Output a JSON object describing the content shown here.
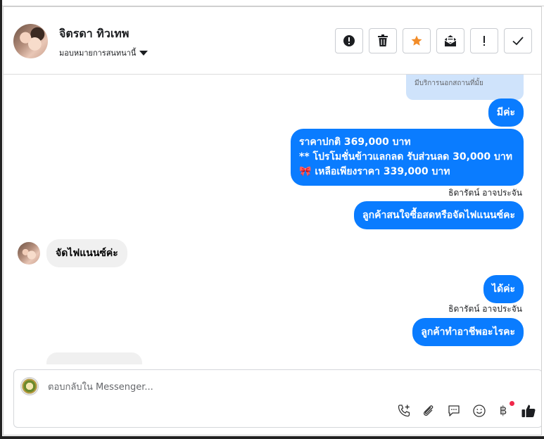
{
  "header": {
    "contact_name": "จิตรดา ทิวเทพ",
    "assign_label": "มอบหมายการสนทนานี้"
  },
  "toolbar": {
    "buttons": [
      {
        "name": "spam",
        "icon": "alert-circle-icon"
      },
      {
        "name": "delete",
        "icon": "trash-icon"
      },
      {
        "name": "star",
        "icon": "star-icon",
        "color": "#f28c28"
      },
      {
        "name": "mark-unread",
        "icon": "envelope-icon"
      },
      {
        "name": "follow-up",
        "icon": "exclamation-icon"
      },
      {
        "name": "done",
        "icon": "check-icon"
      }
    ]
  },
  "conversation": {
    "quoted_text": "มีบริการนอกสถานที่มั้ย",
    "messages": [
      {
        "direction": "out",
        "text": "มีค่ะ"
      },
      {
        "direction": "out",
        "lines": [
          "ราคาปกติ 369,000 บาท",
          "** โปรโมชั่นข้าวแลกลด รับส่วนลด 30,000 บาท",
          "เหลือเพียงราคา 339,000 บาท"
        ],
        "emoji": "🎀"
      },
      {
        "direction": "out",
        "sender": "ธิดารัตน์ อาจประจัน",
        "text": "ลูกค้าสนใจซื้อสดหรือจัดไฟแนนซ์คะ"
      },
      {
        "direction": "in",
        "text": "จัดไฟแนนซ์ค่ะ"
      },
      {
        "direction": "out",
        "text": "ได้ค่ะ"
      },
      {
        "direction": "out",
        "sender": "ธิดารัตน์ อาจประจัน",
        "text": "ลูกค้าทำอาชีพอะไรคะ"
      }
    ]
  },
  "composer": {
    "placeholder": "ตอบกลับใน Messenger...",
    "icons": [
      "phone-plus-icon",
      "paperclip-icon",
      "chat-bubble-icon",
      "smiley-icon",
      "baht-icon",
      "thumbs-up-icon"
    ],
    "baht_symbol": "฿",
    "accent_color": "#0a7cff"
  }
}
